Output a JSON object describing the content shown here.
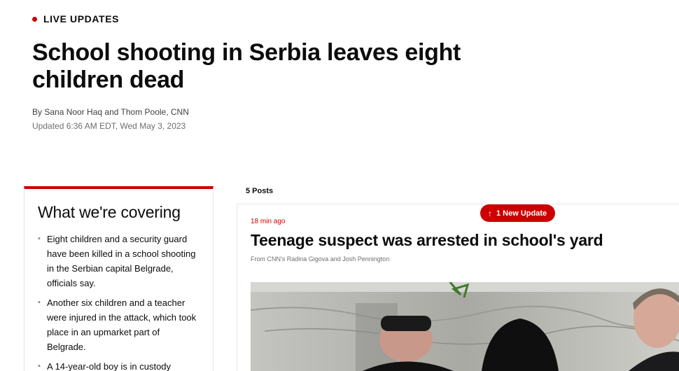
{
  "live": {
    "label": "LIVE UPDATES",
    "dot_color": "#cc0000"
  },
  "article": {
    "headline": "School shooting in Serbia leaves eight children dead",
    "byline": "By Sana Noor Haq and Thom Poole, CNN",
    "updated": "Updated 6:36 AM EDT, Wed May 3, 2023"
  },
  "covering": {
    "title": "What we're covering",
    "items": [
      "Eight children and a security guard have been killed in a school shooting in the Serbian capital Belgrade, officials say.",
      "Another six children and a teacher were injured in the attack, which took place in an upmarket part of Belgrade.",
      "A 14-year-old boy is in custody"
    ]
  },
  "feed": {
    "posts_count": "5 Posts",
    "new_update_label": "1 New Update",
    "new_update_icon": "arrow-up-icon",
    "post": {
      "time": "18 min ago",
      "title": "Teenage suspect was arrested in school's yard",
      "byline": "From CNN's Radina Gigova and Josh Pennington"
    }
  },
  "colors": {
    "accent": "#cc0000",
    "text": "#0c0c0c",
    "muted": "#6e6e6e"
  }
}
